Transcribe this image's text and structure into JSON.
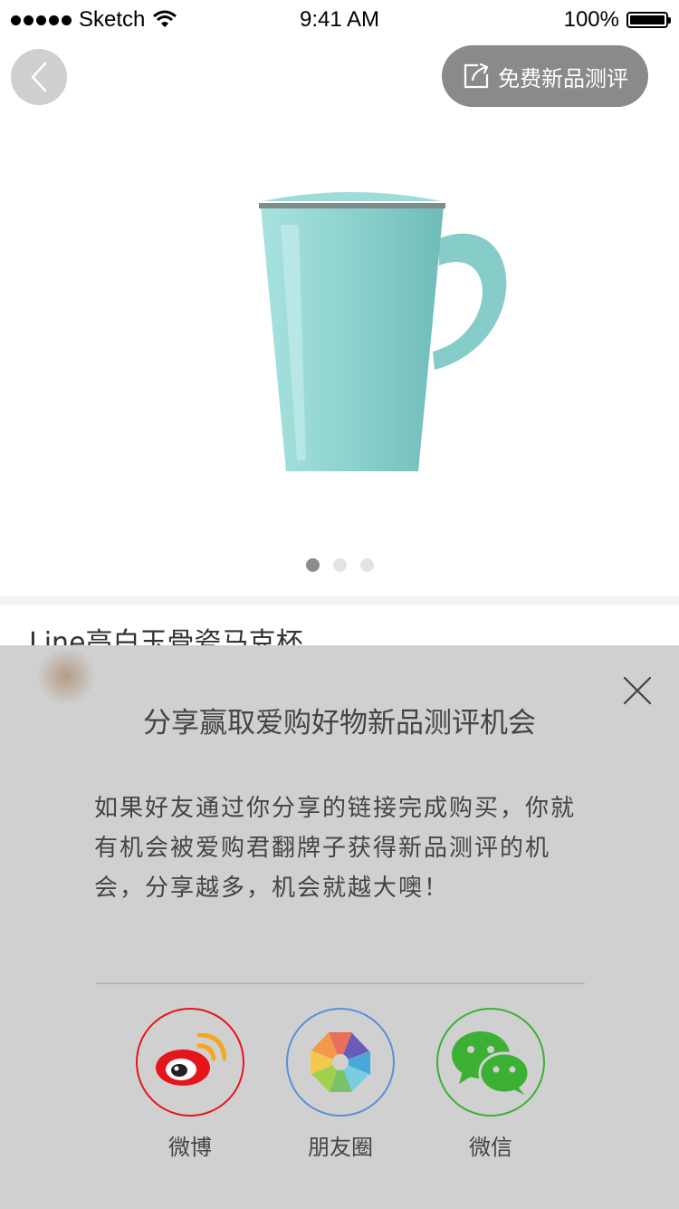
{
  "status_bar": {
    "carrier": "Sketch",
    "time": "9:41 AM",
    "battery": "100%"
  },
  "header": {
    "review_button_label": "免费新品测评",
    "back_icon": "chevron-left-icon",
    "review_icon": "share-edit-icon"
  },
  "gallery": {
    "page_count": 3,
    "active_page": 1
  },
  "product": {
    "title": "Line高白玉骨瓷马克杯"
  },
  "share_panel": {
    "title": "分享赢取爱购好物新品测评机会",
    "description": "如果好友通过你分享的链接完成购买，你就有机会被爱购君翻牌子获得新品测评的机会，分享越多，机会就越大噢！",
    "options": [
      {
        "label": "微博",
        "icon": "weibo-icon",
        "color": "#e5151c"
      },
      {
        "label": "朋友圈",
        "icon": "moments-icon",
        "color": "#5b8fd8"
      },
      {
        "label": "微信",
        "icon": "wechat-icon",
        "color": "#3cb035"
      }
    ]
  },
  "colors": {
    "overlay": "#d0d0d0",
    "review_button": "#8a8a8a",
    "mug": "#8fd3d0"
  }
}
